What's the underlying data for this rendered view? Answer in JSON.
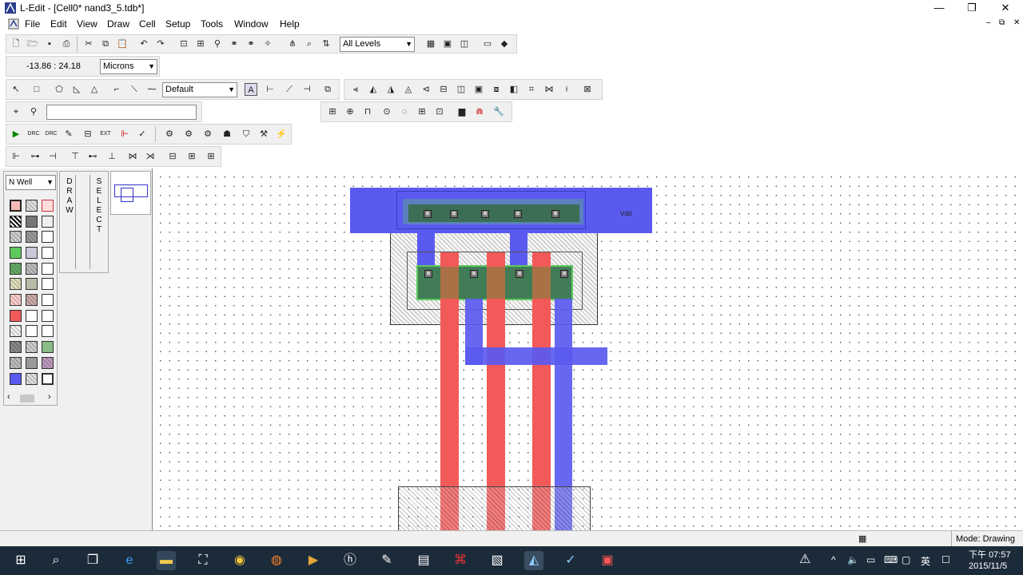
{
  "window": {
    "title": "L-Edit - [Cell0*     nand3_5.tdb*]",
    "minimize_glyph": "—",
    "restore_glyph": "❐",
    "close_glyph": "✕"
  },
  "menu": {
    "items": [
      "File",
      "Edit",
      "View",
      "Draw",
      "Cell",
      "Setup",
      "Tools",
      "Window",
      "Help"
    ],
    "mdi_controls": [
      "–",
      "⧉",
      "✕"
    ]
  },
  "toolbar": {
    "levels_combo": "All Levels",
    "coordinates": "-13.86 : 24.18",
    "units_combo": "Microns",
    "style_combo": "Default",
    "search_value": ""
  },
  "layer_palette": {
    "selected_layer": "N Well",
    "scroll_left": "‹",
    "scroll_right": "›",
    "colors": {
      "nwell": "#f4b8b8",
      "active": "#5ec85e",
      "poly": "#f25a5a",
      "metal1": "#5a5af0"
    }
  },
  "mode_panel": {
    "draw_letters": [
      "D",
      "R",
      "A",
      "W"
    ],
    "select_letters": [
      "S",
      "E",
      "L",
      "E",
      "C",
      "T"
    ]
  },
  "layout": {
    "vdd_label": "Vdd",
    "contact_label": "⊠"
  },
  "statusbar": {
    "mode": "Mode: Drawing"
  },
  "taskbar": {
    "ime": "英",
    "time": "下午 07:57",
    "date": "2015/11/5"
  },
  "colors": {
    "metal1": "#5a5af0",
    "poly": "#f25a5a",
    "active": "#5ec85e",
    "taskbar": "#1c2b3a"
  }
}
